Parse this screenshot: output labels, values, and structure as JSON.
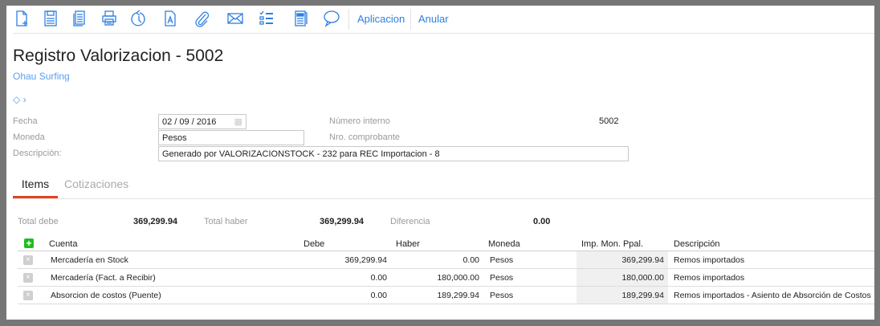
{
  "toolbar": {
    "icons": [
      "new-document-icon",
      "save-icon",
      "copy-icon",
      "print-icon",
      "history-icon",
      "pdf-icon",
      "attach-icon",
      "email-icon",
      "checklist-icon",
      "report-icon",
      "comment-icon"
    ],
    "links": [
      "Aplicacion",
      "Anular"
    ]
  },
  "header": {
    "title": "Registro Valorizacion - 5002",
    "company": "Ohau Surfing"
  },
  "form": {
    "fecha_label": "Fecha",
    "fecha_day": "02",
    "fecha_month": "09",
    "fecha_year": "2016",
    "moneda_label": "Moneda",
    "moneda_value": "Pesos",
    "descripcion_label": "Descripción:",
    "descripcion_value": "Generado por VALORIZACIONSTOCK - 232 para REC Importacion - 8",
    "numero_interno_label": "Número interno",
    "numero_interno_value": "5002",
    "nro_comprobante_label": "Nro. comprobante"
  },
  "tabs": [
    {
      "label": "Items",
      "active": true
    },
    {
      "label": "Cotizaciones",
      "active": false
    }
  ],
  "totals": {
    "debe_label": "Total debe",
    "debe": "369,299.94",
    "haber_label": "Total haber",
    "haber": "369,299.94",
    "diferencia_label": "Diferencia",
    "diferencia": "0.00"
  },
  "table": {
    "columns": [
      "Cuenta",
      "Debe",
      "Haber",
      "Moneda",
      "Imp. Mon. Ppal.",
      "Descripción"
    ],
    "rows": [
      {
        "cuenta": "Mercadería en Stock",
        "debe": "369,299.94",
        "haber": "0.00",
        "moneda": "Pesos",
        "imp": "369,299.94",
        "descripcion": "Remos importados"
      },
      {
        "cuenta": "Mercadería (Fact. a Recibir)",
        "debe": "0.00",
        "haber": "180,000.00",
        "moneda": "Pesos",
        "imp": "180,000.00",
        "descripcion": "Remos importados"
      },
      {
        "cuenta": "Absorcion de costos (Puente)",
        "debe": "0.00",
        "haber": "189,299.94",
        "moneda": "Pesos",
        "imp": "189,299.94",
        "descripcion": "Remos importados - Asiento de Absorción de Costos"
      }
    ]
  },
  "colors": {
    "accent": "#2f7fe0",
    "tab_active": "#e8401c",
    "add": "#22bb22"
  }
}
